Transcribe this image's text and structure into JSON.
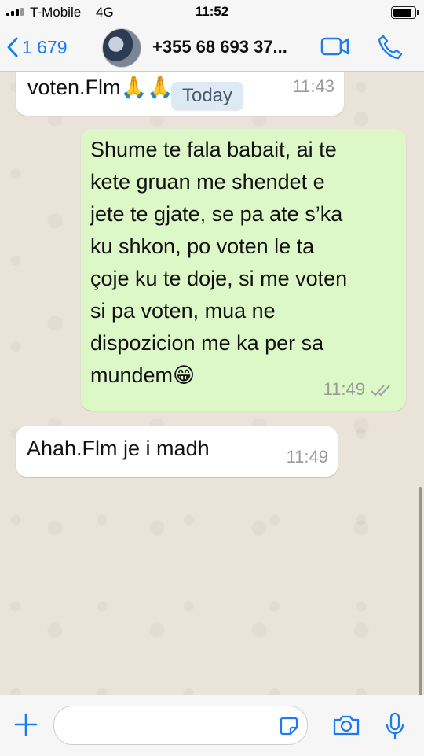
{
  "status_bar": {
    "carrier": "T-Mobile",
    "network": "4G",
    "time": "11:52",
    "battery_level": 0.9
  },
  "nav": {
    "back_count": "1 679",
    "contact": "+355 68 693 37...",
    "icons": [
      "chevron-left-icon",
      "video-call-icon",
      "phone-icon"
    ],
    "accent_color": "#1b7cf0"
  },
  "chat": {
    "date_chip": "Today",
    "messages": [
      {
        "direction": "in",
        "text": "voten.Flm🙏🙏",
        "time": "11:43"
      },
      {
        "direction": "out",
        "lines": [
          "Shume te fala babait, ai te",
          "kete gruan me shendet e",
          "jete te gjate, se pa ate s’ka",
          "ku shkon, po voten le ta",
          "çoje ku te doje, si me voten",
          "si pa voten, mua ne",
          "dispozicion me ka per sa",
          "mundem😁"
        ],
        "time": "11:49",
        "status": "delivered"
      },
      {
        "direction": "in",
        "text": "Ahah.Flm je i madh",
        "time": "11:49"
      }
    ],
    "outgoing_color": "#dcf8c6",
    "incoming_color": "#ffffff"
  },
  "input_bar": {
    "placeholder": "",
    "icons": [
      "plus-icon",
      "sticker-icon",
      "camera-icon",
      "microphone-icon"
    ]
  }
}
